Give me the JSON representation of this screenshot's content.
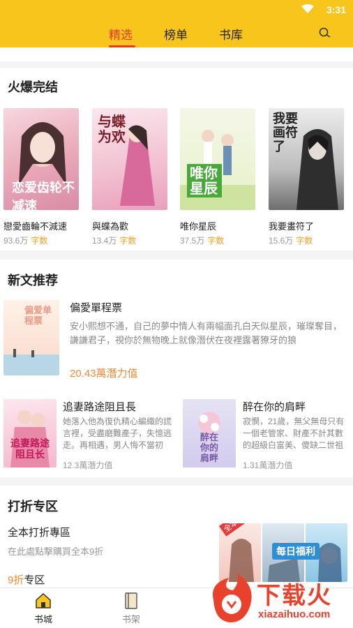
{
  "status": {
    "time": "3:31"
  },
  "header": {
    "tabs": [
      "精选",
      "榜单",
      "书库"
    ],
    "active_tab": "精选"
  },
  "hot_completed": {
    "title": "火爆完结",
    "books": [
      {
        "name": "戀愛齒輪不減速",
        "count": "93.6万",
        "unit": "字数",
        "cover_text": "恋爱齿轮不减速"
      },
      {
        "name": "與蝶為歡",
        "count": "13.4万",
        "unit": "字数",
        "cover_text": "与蝶为欢"
      },
      {
        "name": "唯你星辰",
        "count": "37.5万",
        "unit": "字数",
        "cover_text": "唯你星辰"
      },
      {
        "name": "我要畫符了",
        "count": "15.6万",
        "unit": "字数",
        "cover_text": "我要画符了"
      }
    ]
  },
  "new_recommend": {
    "title": "新文推荐",
    "featured": {
      "name": "偏愛單程票",
      "desc": "安小熙想不通，自己的夢中情人有兩幅面孔白天似星辰，璀璨奪目，謙謙君子，視你於無物晚上就像潛伏在夜裡露著獠牙的狼",
      "potential": "20.43萬潛力值",
      "cover_text": "偏爱单程票"
    },
    "items": [
      {
        "name": "追妻路途阻且長",
        "desc": "她落入他為復仇精心編織的謊言裡，受盡磨難產子，失憶逃走。再相遇，男人悔不當初",
        "potential": "12.3萬潛力值",
        "cover_text": "追妻路途阻且长"
      },
      {
        "name": "醉在你的肩畔",
        "desc": "寂憫，21歲，無父無母只有一個老管家、財產不計其數的超級白富美、傻缺二世祖",
        "potential": "1.31萬潛力值",
        "cover_text": "醉在你的肩畔"
      }
    ]
  },
  "discount": {
    "title": "打折专区",
    "heading": "全本打折專區",
    "sub": "在此處點擊購買全本9折",
    "tag_number": "9折",
    "tag_text": "专区",
    "badge1": "全本9折",
    "badge2": "每日福利"
  },
  "bottom_nav": {
    "items": [
      "书城",
      "书架"
    ]
  },
  "watermark": {
    "text": "下载火",
    "url_text": "xiazaihuo.com"
  },
  "colors": {
    "brand": "#f7c51c",
    "accent": "#e5392c",
    "orange": "#f08a3a"
  }
}
